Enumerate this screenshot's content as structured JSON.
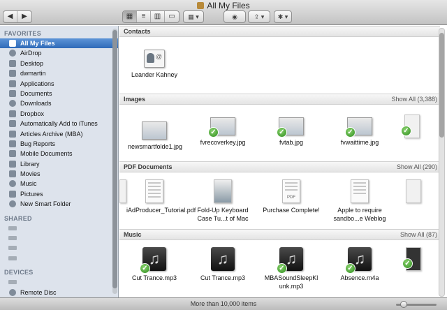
{
  "window": {
    "title": "All My Files"
  },
  "toolbar": {
    "back_glyph": "◀",
    "forward_glyph": "▶",
    "view_icons": [
      "▦",
      "≡",
      "▥",
      "▭"
    ],
    "arrange_glyph": "▦ ▾",
    "quicklook_glyph": "◉",
    "share_glyph": "⇪ ▾",
    "action_glyph": "✱ ▾"
  },
  "sidebar": {
    "favorites_header": "FAVORITES",
    "favorites": [
      {
        "label": "All My Files",
        "icon": "all-files-icon",
        "selected": true
      },
      {
        "label": "AirDrop",
        "icon": "airdrop-icon"
      },
      {
        "label": "Desktop",
        "icon": "desktop-icon"
      },
      {
        "label": "dwmartin",
        "icon": "home-icon"
      },
      {
        "label": "Applications",
        "icon": "applications-icon"
      },
      {
        "label": "Documents",
        "icon": "documents-icon"
      },
      {
        "label": "Downloads",
        "icon": "downloads-icon"
      },
      {
        "label": "Dropbox",
        "icon": "dropbox-icon"
      },
      {
        "label": "Automatically Add to iTunes",
        "icon": "folder-icon"
      },
      {
        "label": "Articles Archive (MBA)",
        "icon": "folder-icon"
      },
      {
        "label": "Bug Reports",
        "icon": "folder-icon"
      },
      {
        "label": "Mobile Documents",
        "icon": "folder-icon"
      },
      {
        "label": "Library",
        "icon": "folder-icon"
      },
      {
        "label": "Movies",
        "icon": "movies-icon"
      },
      {
        "label": "Music",
        "icon": "music-icon"
      },
      {
        "label": "Pictures",
        "icon": "pictures-icon"
      },
      {
        "label": "New Smart Folder",
        "icon": "smart-folder-icon"
      }
    ],
    "shared_header": "SHARED",
    "shared_count": 4,
    "devices_header": "DEVICES",
    "devices": [
      {
        "label": "",
        "icon": "hard-drive-icon"
      },
      {
        "label": "Remote Disc",
        "icon": "remote-disc-icon"
      }
    ]
  },
  "groups": {
    "contacts": {
      "title": "Contacts",
      "items": [
        {
          "label": "Leander Kahney",
          "icon": "contact-card-icon"
        }
      ]
    },
    "images": {
      "title": "Images",
      "show_all": "Show All (3,388)",
      "items": [
        {
          "label": "newsmartfolde1.jpg",
          "icon": "image-thumbnail-icon",
          "badge": false
        },
        {
          "label": "fvrecoverkey.jpg",
          "icon": "image-thumbnail-icon",
          "badge": true
        },
        {
          "label": "fvtab.jpg",
          "icon": "image-thumbnail-icon",
          "badge": true
        },
        {
          "label": "fvwaittime.jpg",
          "icon": "image-thumbnail-icon",
          "badge": true
        }
      ]
    },
    "pdfs": {
      "title": "PDF Documents",
      "show_all": "Show All (290)",
      "items": [
        {
          "label": "iAdProducer_Tutorial.pdf",
          "icon": "pdf-document-icon",
          "badge": false
        },
        {
          "label": "Fold-Up Keyboard Case Tu...t of Mac",
          "icon": "pdf-document-icon",
          "badge": false
        },
        {
          "label": "Purchase Complete!",
          "icon": "pdf-document-icon",
          "badge": false,
          "tag": "PDF"
        },
        {
          "label": "Apple to require sandbo...e Weblog",
          "icon": "pdf-document-icon",
          "badge": false
        }
      ]
    },
    "music": {
      "title": "Music",
      "show_all": "Show All (87)",
      "items": [
        {
          "label": "Cut Trance.mp3",
          "icon": "music-file-icon",
          "badge": true
        },
        {
          "label": "Cut Trance.mp3",
          "icon": "music-file-icon",
          "badge": false
        },
        {
          "label": "MBASoundSleepKl unk.mp3",
          "icon": "music-file-icon",
          "badge": true
        },
        {
          "label": "Absence.m4a",
          "icon": "music-file-icon",
          "badge": true
        }
      ],
      "note_glyph": "♫"
    }
  },
  "status": {
    "text": "More than 10,000 items"
  },
  "colors": {
    "sidebar_bg": "#dde3ec",
    "selection": "#3d79c6",
    "badge_green": "#3c9a2a"
  }
}
